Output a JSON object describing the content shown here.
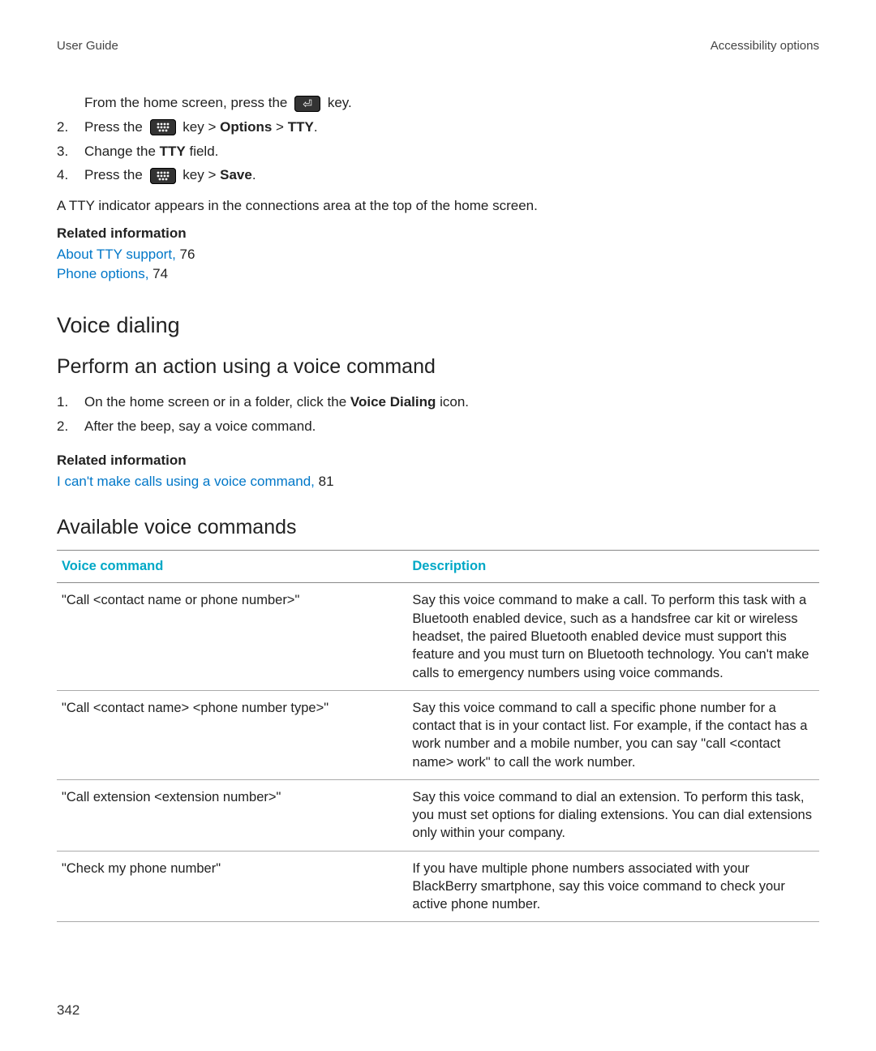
{
  "header": {
    "left": "User Guide",
    "right": "Accessibility options"
  },
  "instr": {
    "pre_line": {
      "before_icon": "From the home screen, press the ",
      "after_icon": " key."
    },
    "step2": {
      "before_icon": "Press the ",
      "after_icon1": " key > ",
      "options": "Options",
      "sep": " > ",
      "tty": "TTY",
      "end": "."
    },
    "step3": {
      "before": "Change the ",
      "bold": "TTY",
      "after": " field."
    },
    "step4": {
      "before_icon": "Press the ",
      "after_icon1": " key > ",
      "save": "Save",
      "end": "."
    },
    "nums": {
      "n2": "2.",
      "n3": "3.",
      "n4": "4."
    }
  },
  "tty_note": "A TTY indicator appears in the connections area at the top of the home screen.",
  "related1": {
    "title": "Related information",
    "link1": "About TTY support,",
    "link1_page": " 76",
    "link2": "Phone options,",
    "link2_page": " 74"
  },
  "voice_dialing_heading": "Voice dialing",
  "perform_heading": "Perform an action using a voice command",
  "perform_steps": {
    "n1": "1.",
    "s1_before": "On the home screen or in a folder, click the ",
    "s1_bold": "Voice Dialing",
    "s1_after": " icon.",
    "n2": "2.",
    "s2": "After the beep, say a voice command."
  },
  "related2": {
    "title": "Related information",
    "link1": "I can't make calls using a voice command,",
    "link1_page": " 81"
  },
  "avail_heading": "Available voice commands",
  "table": {
    "head": {
      "c1": "Voice command",
      "c2": "Description"
    },
    "rows": [
      {
        "cmd": "\"Call <contact name or phone number>\"",
        "desc": "Say this voice command to make a call. To perform this task with a Bluetooth enabled device, such as a handsfree car kit or wireless headset, the paired Bluetooth enabled device must support this feature and you must turn on Bluetooth technology. You can't make calls to emergency numbers using voice commands."
      },
      {
        "cmd": "\"Call <contact name> <phone number type>\"",
        "desc": "Say this voice command to call a specific phone number for a contact that is in your contact list. For example, if the contact has a work number and a mobile number, you can say \"call <contact name> work\" to call the work number."
      },
      {
        "cmd": "\"Call extension <extension number>\"",
        "desc": "Say this voice command to dial an extension. To perform this task, you must set options for dialing extensions. You can dial extensions only within your company."
      },
      {
        "cmd": "\"Check my phone number\"",
        "desc": "If you have multiple phone numbers associated with your BlackBerry smartphone, say this voice command to check your active phone number."
      }
    ]
  },
  "page_number": "342"
}
